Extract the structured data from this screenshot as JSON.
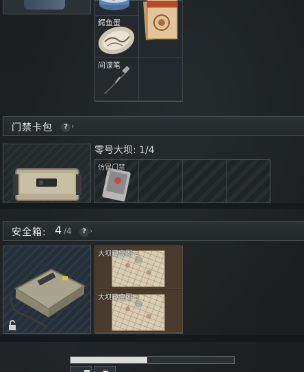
{
  "top_inventory": {
    "cells": [
      {
        "label": "",
        "icon": "canned-food-icon"
      },
      {
        "label": "",
        "icon": "documents-icon"
      },
      {
        "label": "鳄鱼蛋",
        "icon": "crocodile-egg-icon"
      },
      {
        "label": "",
        "icon": ""
      },
      {
        "label": "间谍笔",
        "icon": "spy-pen-icon"
      },
      {
        "label": "",
        "icon": ""
      }
    ]
  },
  "keycard_case": {
    "title": "门禁卡包",
    "help": "?",
    "slot_label": "零号大坝: 1/4",
    "cards": [
      {
        "label": "仿冒门禁",
        "icon": "forged-keycard-icon"
      },
      {
        "label": "",
        "icon": ""
      },
      {
        "label": "",
        "icon": ""
      },
      {
        "label": "",
        "icon": ""
      }
    ]
  },
  "safe_box": {
    "title": "安全箱:",
    "count": "4",
    "capacity": "/4",
    "help": "?",
    "lock_icon": "lock-icon",
    "items": [
      {
        "label": "大坝藏宝图-3",
        "icon": "treasure-map-icon"
      },
      {
        "label": "大坝藏宝图-3",
        "icon": "treasure-map-icon"
      }
    ]
  },
  "bottom": {
    "progress": 0.47
  },
  "colors": {
    "panel_border": "#4a5256",
    "safe_item_bg": "#4a3b2c",
    "progress_fill": "#dcdcdc"
  }
}
